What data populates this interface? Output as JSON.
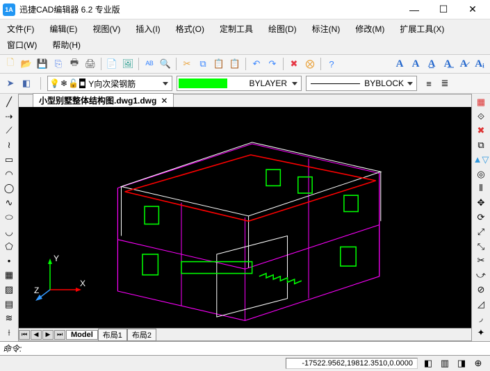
{
  "app": {
    "logo": "1A",
    "title": "迅捷CAD编辑器 6.2 专业版"
  },
  "wincontrols": {
    "min": "—",
    "max": "☐",
    "close": "✕"
  },
  "menus": [
    "文件(F)",
    "编辑(E)",
    "视图(V)",
    "插入(I)",
    "格式(O)",
    "定制工具",
    "绘图(D)",
    "标注(N)",
    "修改(M)",
    "扩展工具(X)",
    "窗口(W)",
    "帮助(H)"
  ],
  "toolbar_std": [
    {
      "n": "new-icon",
      "g": "🗋",
      "c": "#e9c46a"
    },
    {
      "n": "open-icon",
      "g": "📂",
      "c": "#e9a23b"
    },
    {
      "n": "save-icon",
      "g": "💾",
      "c": "#4b7bec"
    },
    {
      "n": "export-icon",
      "g": "⎘",
      "c": "#4b7bec"
    },
    {
      "n": "print-icon",
      "g": "🖶",
      "c": "#555"
    },
    {
      "n": "print-preview-icon",
      "g": "🖨",
      "c": "#555"
    },
    {
      "sep": true
    },
    {
      "n": "pdf-icon",
      "g": "📄",
      "c": "#2a9d8f"
    },
    {
      "n": "image-icon",
      "g": "🖼",
      "c": "#2a9d8f"
    },
    {
      "sep": true
    },
    {
      "n": "spellcheck-icon",
      "g": "ᴬᴮ",
      "c": "#3a86ff"
    },
    {
      "n": "find-icon",
      "g": "🔍",
      "c": "#333"
    },
    {
      "sep": true
    },
    {
      "n": "cut-icon",
      "g": "✂",
      "c": "#e9a23b"
    },
    {
      "n": "copy-icon",
      "g": "⧉",
      "c": "#3a86ff"
    },
    {
      "n": "paste-icon",
      "g": "📋",
      "c": "#3a86ff"
    },
    {
      "n": "paste-special-icon",
      "g": "📋",
      "c": "#888"
    },
    {
      "sep": true
    },
    {
      "n": "undo-icon",
      "g": "↶",
      "c": "#3a86ff"
    },
    {
      "n": "redo-icon",
      "g": "↷",
      "c": "#3a86ff"
    },
    {
      "sep": true
    },
    {
      "n": "erase-icon",
      "g": "✖",
      "c": "#e63946"
    },
    {
      "n": "oops-icon",
      "g": "⨂",
      "c": "#e9a23b"
    },
    {
      "sep": true
    },
    {
      "n": "help-icon",
      "g": "?",
      "c": "#3a86ff"
    }
  ],
  "toolbar_text": [
    {
      "n": "a1",
      "g": "A",
      "c": "#2266cc"
    },
    {
      "n": "a2",
      "g": "A",
      "c": "#2266cc"
    },
    {
      "n": "a3",
      "g": "A̲",
      "c": "#2266cc"
    },
    {
      "n": "a4",
      "g": "A͟",
      "c": "#2266cc"
    },
    {
      "n": "a5",
      "g": "A̷",
      "c": "#2266cc"
    },
    {
      "n": "a6",
      "g": "Aᵢ",
      "c": "#2266cc"
    }
  ],
  "prop": {
    "layer_icons": [
      {
        "n": "layer-mgr-icon",
        "g": "➤",
        "c": "#46a"
      },
      {
        "n": "layer-states-icon",
        "g": "◧",
        "c": "#46a"
      }
    ],
    "layer_state": [
      {
        "n": "bulb-icon",
        "g": "💡"
      },
      {
        "n": "freeze-icon",
        "g": "❄"
      },
      {
        "n": "lock-icon",
        "g": "🔓"
      },
      {
        "n": "square-icon",
        "g": "■",
        "c": "#fff"
      }
    ],
    "layer_name": "Y向次梁钢筋",
    "color": {
      "swatch": "#00ff00",
      "label": "BYLAYER"
    },
    "linetype": {
      "label": "BYBLOCK"
    },
    "lw_icons": [
      {
        "n": "lw1",
        "g": "≡"
      },
      {
        "n": "lw2",
        "g": "≣"
      }
    ]
  },
  "left_tools": [
    {
      "n": "line-icon",
      "g": "╱"
    },
    {
      "n": "ray-icon",
      "g": "⇢"
    },
    {
      "n": "xline-icon",
      "g": "⟋"
    },
    {
      "n": "pline-icon",
      "g": "≀"
    },
    {
      "n": "rect-icon",
      "g": "▭"
    },
    {
      "n": "arc-icon",
      "g": "◠"
    },
    {
      "n": "circle-icon",
      "g": "◯"
    },
    {
      "n": "spline-icon",
      "g": "∿"
    },
    {
      "n": "ellipse-icon",
      "g": "⬭"
    },
    {
      "n": "ellipse-arc-icon",
      "g": "◡"
    },
    {
      "n": "polygon-icon",
      "g": "⬠"
    },
    {
      "n": "point-icon",
      "g": "•"
    },
    {
      "n": "block-icon",
      "g": "▦"
    },
    {
      "n": "hatch-icon",
      "g": "▨"
    },
    {
      "n": "region-icon",
      "g": "▤"
    },
    {
      "n": "mline-icon",
      "g": "≋"
    },
    {
      "n": "dim-icon",
      "g": "⟊"
    }
  ],
  "right_tools": [
    {
      "n": "props-icon",
      "g": "▦",
      "c": "#d33"
    },
    {
      "n": "match-icon",
      "g": "⟐"
    },
    {
      "n": "delete-icon",
      "g": "✖",
      "c": "#d33"
    },
    {
      "n": "copy2-icon",
      "g": "⧉"
    },
    {
      "n": "mirror-icon",
      "g": "▲▽",
      "c": "#39d"
    },
    {
      "n": "offset-icon",
      "g": "◎"
    },
    {
      "n": "array-icon",
      "g": "⦀"
    },
    {
      "n": "move-icon",
      "g": "✥"
    },
    {
      "n": "rotate-icon",
      "g": "⟳"
    },
    {
      "n": "scale-icon",
      "g": "⤢"
    },
    {
      "n": "stretch-icon",
      "g": "⤡"
    },
    {
      "n": "trim-icon",
      "g": "✂"
    },
    {
      "n": "extend-icon",
      "g": "⤻"
    },
    {
      "n": "break-icon",
      "g": "⊘"
    },
    {
      "n": "chamfer-icon",
      "g": "◿"
    },
    {
      "n": "fillet-icon",
      "g": "◞"
    },
    {
      "n": "explode-icon",
      "g": "✦"
    }
  ],
  "file_tab": {
    "name": "小型别墅整体结构图.dwg1.dwg",
    "close": "✕"
  },
  "model_tabs": {
    "nav": [
      "⏮",
      "◀",
      "▶",
      "⏭"
    ],
    "tabs": [
      "Model",
      "布局1",
      "布局2"
    ]
  },
  "axis": {
    "x": "X",
    "y": "Y",
    "z": "Z"
  },
  "cmd": {
    "label": "命令:"
  },
  "status": {
    "coords": "-17522.9562,19812.3510,0.0000",
    "btns": [
      "◧",
      "▥",
      "◨",
      "⊕"
    ]
  }
}
